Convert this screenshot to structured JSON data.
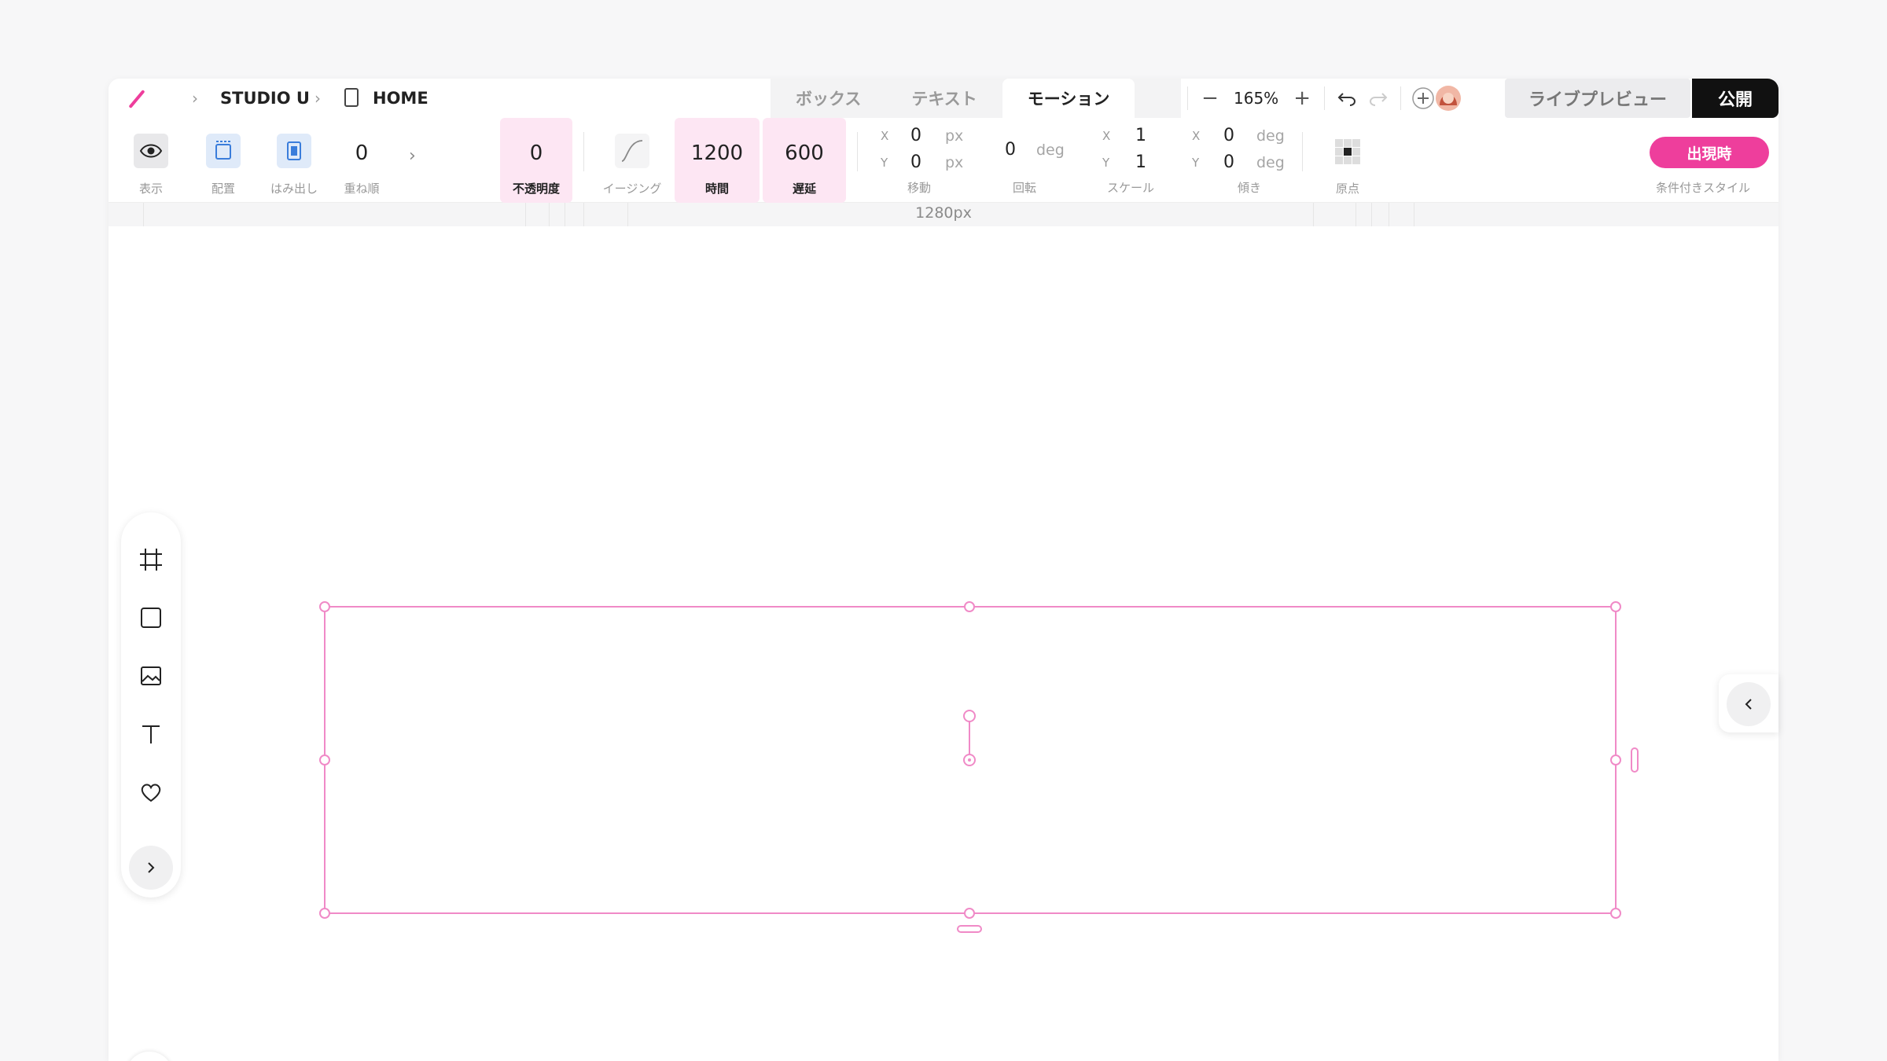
{
  "breadcrumb": {
    "project": "STUDIO U",
    "page": "HOME"
  },
  "tabs": [
    {
      "label": "ボックス",
      "active": false
    },
    {
      "label": "テキスト",
      "active": false
    },
    {
      "label": "モーション",
      "active": true
    }
  ],
  "zoom": {
    "value": "165%",
    "minus": "−",
    "plus": "+"
  },
  "live_preview": "ライブプレビュー",
  "publish": "公開",
  "toolbar": {
    "display_label": "表示",
    "placement_label": "配置",
    "overflow_label": "はみ出し",
    "zorder_value": "0",
    "zorder_label": "重ね順",
    "opacity_value": "0",
    "opacity_label": "不透明度",
    "easing_label": "イージング",
    "duration_value": "1200",
    "duration_label": "時間",
    "delay_value": "600",
    "delay_label": "遅延",
    "move": {
      "label": "移動",
      "x_axis": "X",
      "y_axis": "Y",
      "x": "0",
      "y": "0",
      "unit": "px"
    },
    "rotate": {
      "label": "回転",
      "value": "0",
      "unit": "deg"
    },
    "scale": {
      "label": "スケール",
      "x_axis": "X",
      "y_axis": "Y",
      "x": "1",
      "y": "1"
    },
    "skew": {
      "label": "傾き",
      "x_axis": "X",
      "y_axis": "Y",
      "x": "0",
      "y": "0",
      "unit": "deg"
    },
    "origin_label": "原点",
    "conditional_button": "出現時",
    "conditional_label": "条件付きスタイル"
  },
  "ruler": {
    "width_label": "1280px"
  },
  "colors": {
    "accent": "#ee3e9c",
    "selection": "#f08ac7",
    "pink_bg": "#fde6f3",
    "dark": "#111111"
  },
  "left_tools": [
    "frame-icon",
    "box-icon",
    "image-icon",
    "text-icon",
    "heart-icon",
    "chevron-right-icon"
  ]
}
